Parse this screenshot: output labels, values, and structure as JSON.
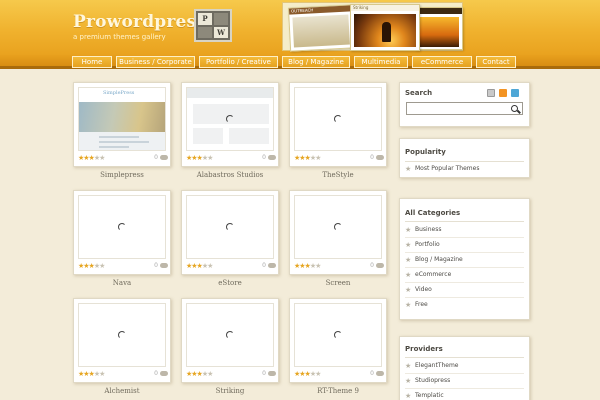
{
  "site": {
    "title": "Prowordpress",
    "tagline": "a premium themes gallery",
    "logo_letters": [
      "P",
      "",
      "",
      "W"
    ]
  },
  "header_thumbs": [
    {
      "label": "OUTREACH"
    },
    {
      "label": "Striking"
    },
    {
      "label": ""
    }
  ],
  "nav": [
    {
      "label": "Home"
    },
    {
      "label": "Business / Corporate"
    },
    {
      "label": "Portfolio / Creative"
    },
    {
      "label": "Blog / Magazine"
    },
    {
      "label": "Multimedia"
    },
    {
      "label": "eCommerce"
    },
    {
      "label": "Contact"
    }
  ],
  "themes": [
    {
      "name": "Simplepress",
      "rating": 3,
      "comments": "0"
    },
    {
      "name": "Alabastros Studios",
      "rating": 3,
      "comments": "0"
    },
    {
      "name": "TheStyle",
      "rating": 3,
      "comments": "0"
    },
    {
      "name": "Nava",
      "rating": 3,
      "comments": "0"
    },
    {
      "name": "eStore",
      "rating": 3,
      "comments": "0"
    },
    {
      "name": "Screen",
      "rating": 3,
      "comments": "0"
    },
    {
      "name": "Alchemist",
      "rating": 3,
      "comments": "0"
    },
    {
      "name": "Striking",
      "rating": 3,
      "comments": "0"
    },
    {
      "name": "RT-Theme 9",
      "rating": 3,
      "comments": "0"
    }
  ],
  "simplepress_logo": "SimplePress",
  "sidebar": {
    "search": {
      "title": "Search",
      "placeholder": ""
    },
    "popularity": {
      "title": "Popularity",
      "items": [
        "Most Popular Themes"
      ]
    },
    "categories": {
      "title": "All Categories",
      "items": [
        "Business",
        "Portfolio",
        "Blog / Magazine",
        "eCommerce",
        "Video",
        "Free"
      ]
    },
    "providers": {
      "title": "Providers",
      "items": [
        "ElegantTheme",
        "Studiopress",
        "Templatic"
      ]
    }
  },
  "colors": {
    "accent": "#f0b22e",
    "nav": "#e09716",
    "background": "#f3ecd9",
    "star": "#e6a623"
  }
}
